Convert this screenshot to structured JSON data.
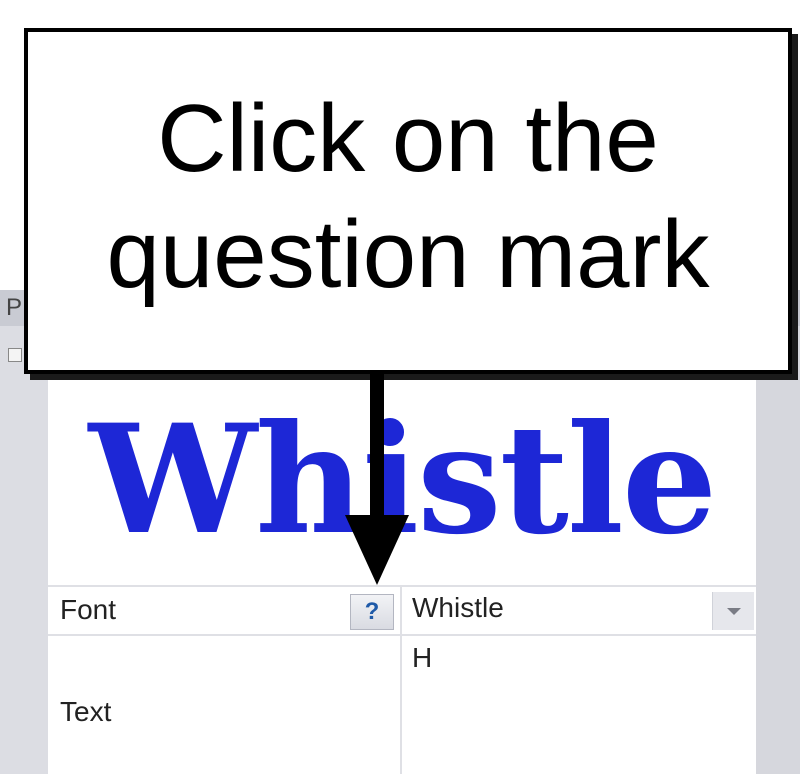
{
  "background": {
    "left_tab_label": "P"
  },
  "preview": {
    "text": "Whistle",
    "fill_color": "#1d27d6"
  },
  "properties": {
    "font": {
      "label": "Font",
      "help_icon": "?",
      "value": "Whistle",
      "dropdown_icon": "chevron-down-icon"
    },
    "text": {
      "label": "Text",
      "value": "H"
    }
  },
  "callout": {
    "text": "Click on the\nquestion mark"
  }
}
